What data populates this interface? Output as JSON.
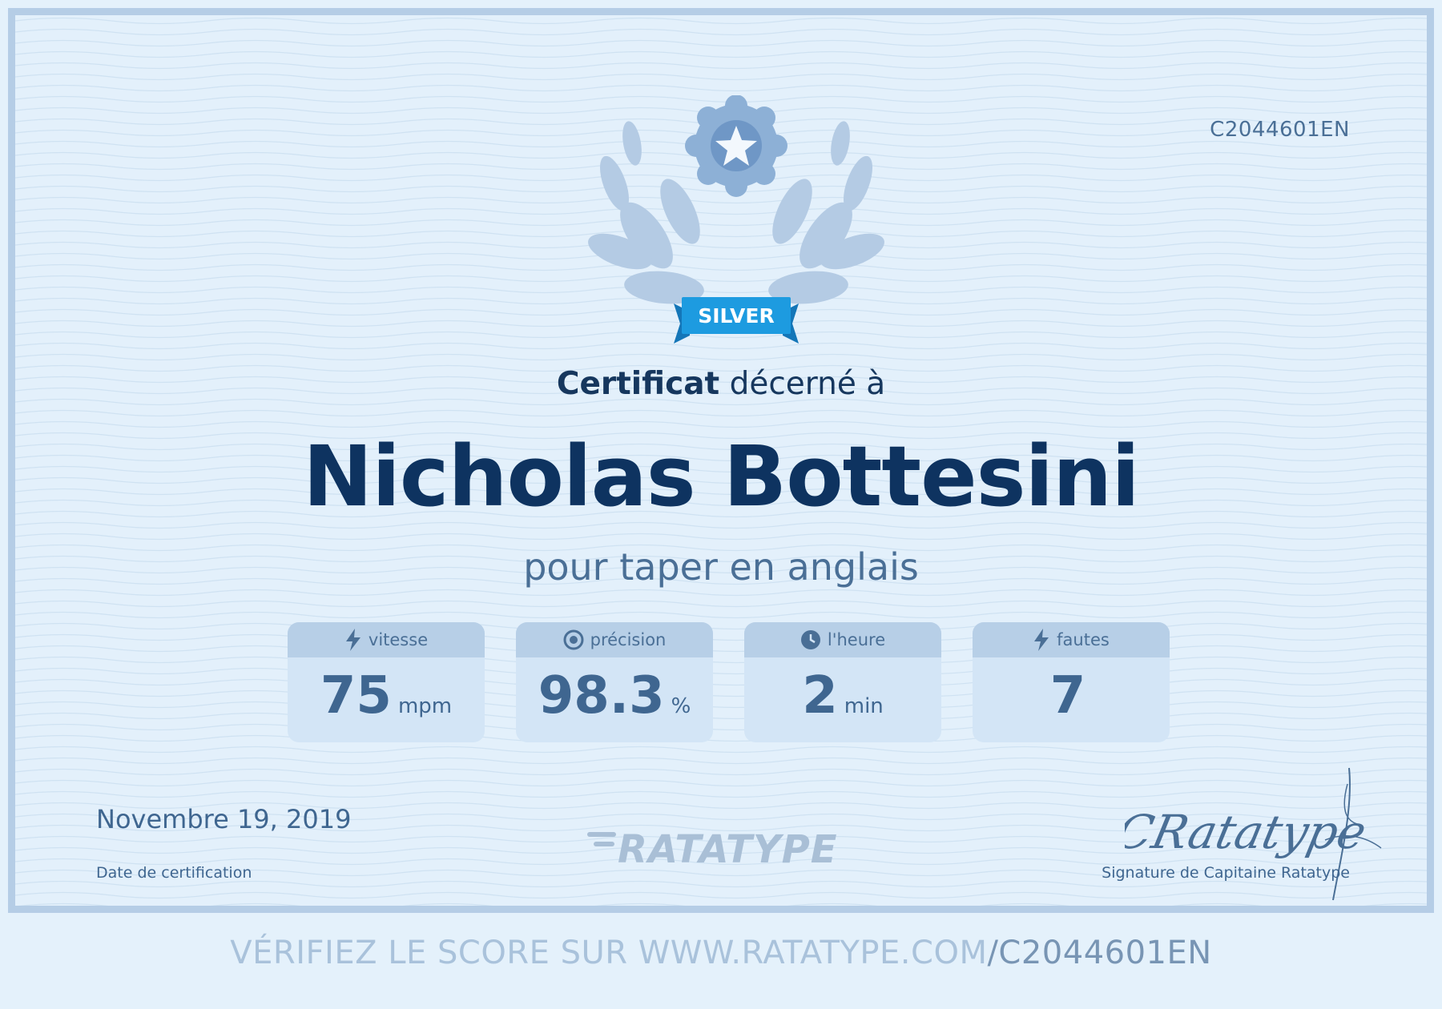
{
  "certificate": {
    "code": "C2044601EN",
    "badge_label": "SILVER",
    "awarded_bold": "Certificat",
    "awarded_rest": "décerné à",
    "recipient": "Nicholas Bottesini",
    "subtitle": "pour taper en anglais",
    "date": "Novembre 19, 2019",
    "date_label": "Date de certification",
    "logo_text": "RATATYPE",
    "signature_label": "Signature de Capitaine Ratatype",
    "signature_script": "CRatatype"
  },
  "stats": [
    {
      "icon": "lightning-icon",
      "label": "vitesse",
      "value": "75",
      "unit": "mpm"
    },
    {
      "icon": "target-icon",
      "label": "précision",
      "value": "98.3",
      "unit": "%"
    },
    {
      "icon": "clock-icon",
      "label": "l'heure",
      "value": "2",
      "unit": "min"
    },
    {
      "icon": "lightning-icon",
      "label": "fautes",
      "value": "7",
      "unit": ""
    }
  ],
  "footer": {
    "verify_prefix": "VÉRIFIEZ LE SCORE SUR WWW.RATATYPE.COM",
    "verify_code": "/C2044601EN"
  },
  "colors": {
    "navy": "#0e3360",
    "muted_blue": "#4a6f96",
    "badge_blue": "#1d9be0",
    "border": "#b5cde6",
    "background": "#e3f0fb"
  }
}
